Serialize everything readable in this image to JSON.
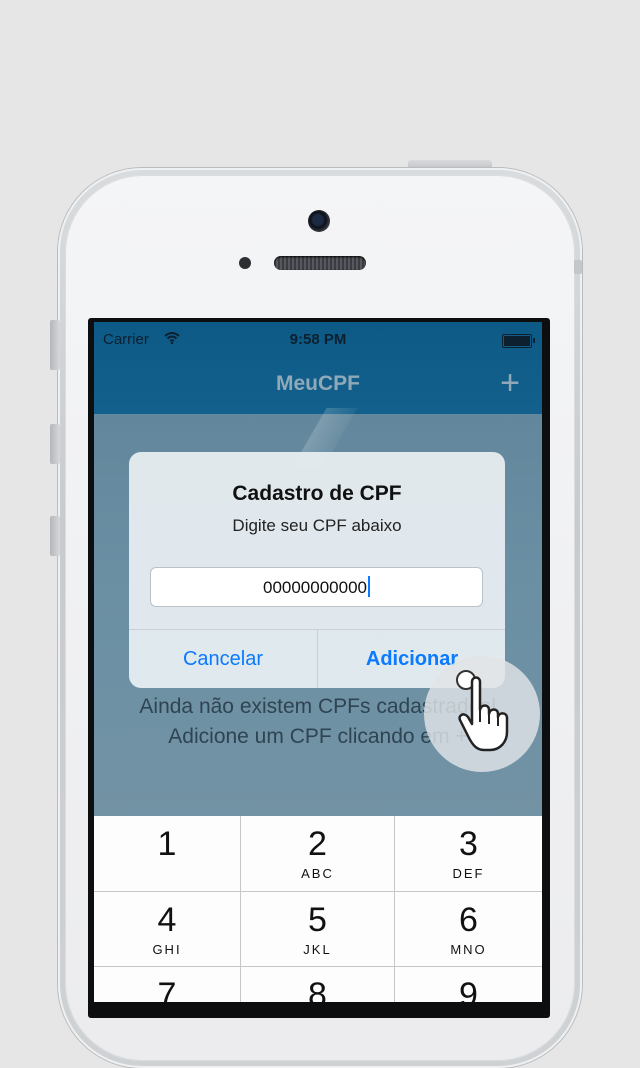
{
  "status_bar": {
    "carrier": "Carrier",
    "time": "9:58 PM"
  },
  "navbar": {
    "title": "MeuCPF",
    "add_symbol": "+"
  },
  "alert": {
    "title": "Cadastro de CPF",
    "message": "Digite seu CPF abaixo",
    "input_value": "00000000000",
    "cancel_label": "Cancelar",
    "add_label": "Adicionar"
  },
  "empty_state": {
    "line1": "Ainda não existem CPFs cadastrados!",
    "line2": "Adicione um CPF clicando em +"
  },
  "keyboard": {
    "keys": [
      {
        "number": "1",
        "letters": ""
      },
      {
        "number": "2",
        "letters": "ABC"
      },
      {
        "number": "3",
        "letters": "DEF"
      },
      {
        "number": "4",
        "letters": "GHI"
      },
      {
        "number": "5",
        "letters": "JKL"
      },
      {
        "number": "6",
        "letters": "MNO"
      },
      {
        "number": "7",
        "letters": ""
      },
      {
        "number": "8",
        "letters": ""
      },
      {
        "number": "9",
        "letters": ""
      }
    ]
  },
  "colors": {
    "accent": "#0a7aff",
    "navbar": "#0e5a86"
  }
}
